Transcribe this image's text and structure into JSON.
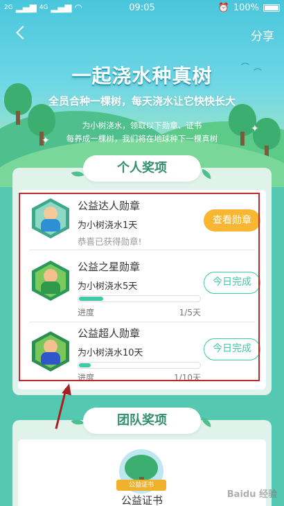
{
  "status_bar": {
    "carrier1": "2G",
    "carrier2": "4G",
    "time": "09:05",
    "battery": "100%"
  },
  "header": {
    "share_label": "分享",
    "title": "一起浇水种真树",
    "subtitle": "全员合种一棵树，每天浇水让它快快长大",
    "desc_line1": "为小树浇水，领取以下勋章、证书",
    "desc_line2": "每养成一棵树，我们将在地球种下一棵真树"
  },
  "personal": {
    "section_title": "个人奖项",
    "awards": [
      {
        "name": "公益达人勋章",
        "requirement": "为小树浇水1天",
        "note": "恭喜已获得勋章!",
        "button": "查看勋章"
      },
      {
        "name": "公益之星勋章",
        "requirement": "为小树浇水5天",
        "progress_label": "进度",
        "progress_text": "1/5天",
        "progress": 0.2,
        "button": "今日完成"
      },
      {
        "name": "公益超人勋章",
        "requirement": "为小树浇水10天",
        "progress_label": "进度",
        "progress_text": "1/10天",
        "progress": 0.1,
        "button": "今日完成"
      }
    ]
  },
  "team": {
    "section_title": "团队奖项",
    "ribbon": "公益证书",
    "certificate": "公益证书"
  },
  "watermark": "Baidu 经验",
  "colors": {
    "accent": "#3ec9a7",
    "button_orange": "#f8b632",
    "highlight_red": "#c0282e"
  }
}
